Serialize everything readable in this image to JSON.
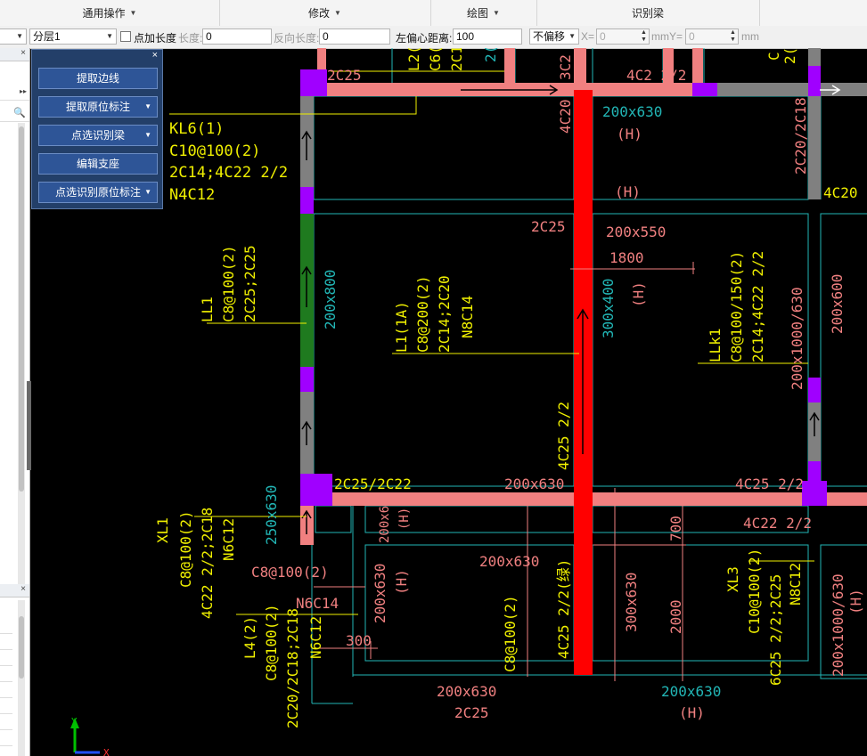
{
  "ribbon": {
    "groups": [
      {
        "label": "通用操作",
        "caret": "▼"
      },
      {
        "label": "修改",
        "caret": "▼"
      },
      {
        "label": "绘图",
        "caret": "▼"
      },
      {
        "label": "识别梁",
        "caret": ""
      }
    ]
  },
  "options": {
    "layer_value": "分层1",
    "add_length_label": "点加长度",
    "length_label": "长度:",
    "length_value": "0",
    "reverse_length_label": "反向长度:",
    "reverse_length_value": "0",
    "left_offset_label": "左偏心距离:",
    "left_offset_value": "100",
    "offset_mode_value": "不偏移",
    "x_label": "X=",
    "x_value": "0",
    "mm_y_label": "mmY=",
    "y_value": "0",
    "mm_label": "mm"
  },
  "left_pane": {
    "close": "×",
    "arrows": "▸▸",
    "close2": "×"
  },
  "tool_panel": {
    "close": "×",
    "buttons": [
      {
        "label": "提取边线",
        "caret": ""
      },
      {
        "label": "提取原位标注",
        "caret": "▼"
      },
      {
        "label": "点选识别梁",
        "caret": "▼"
      },
      {
        "label": "编辑支座",
        "caret": ""
      },
      {
        "label": "点选识别原位标注",
        "caret": "▼"
      }
    ]
  },
  "colors": {
    "pink": "#f08080",
    "red": "#ff0000",
    "cyan": "#22b6b6",
    "yellow": "#f0f000",
    "purple": "#a000ff",
    "gray": "#808080",
    "green": "#1f7a1f"
  },
  "drawing": {
    "kl6": [
      "KL6(1)",
      "C10@100(2)",
      "2C14;4C22 2/2",
      "N4C12"
    ],
    "ll1": [
      "LL1",
      "C8@100(2)",
      "2C25;2C25"
    ],
    "l1": [
      "L1(1A)",
      "C8@200(2)",
      "2C14;2C20",
      "N8C14"
    ],
    "llk1": [
      "LLk1",
      "C8@100/150(2)",
      "2C14;4C22 2/2"
    ],
    "xl1": [
      "XL1",
      "C8@100(2)",
      "4C22 2/2;2C18",
      "N6C12"
    ],
    "l4": [
      "L4(2)",
      "C8@100(2)",
      "2C20/2C18;2C18",
      "N6C12"
    ],
    "xl3": [
      "XL3",
      "C10@100(2)",
      "6C25 2/2;2C25",
      "N8C12"
    ],
    "top_fragments": [
      "2C25",
      "L2(",
      "C6(",
      "2C1",
      "2(",
      "3C2",
      "4C2 2/2",
      "C",
      "2("
    ],
    "pink_texts": [
      "4C20",
      "2C25",
      "200x550",
      "1800",
      "200x630",
      "2C25/2C22",
      "4C25 2/2",
      "4C22 2/2",
      "200x630",
      "C8@100(2)",
      "N6C14",
      "300",
      "200x63",
      "200x630",
      "200x630",
      "C8@100(2)",
      "300x630",
      "2000",
      "700",
      "200x630",
      "(H)",
      "(H)",
      "(H)",
      "(H)",
      "(H)",
      "(H)",
      "(H)",
      "2C25",
      "200x1000/630",
      "(H)"
    ],
    "cyan_texts": [
      "200x630",
      "(H)",
      "200x800",
      "300x400",
      "(H)",
      "200x600",
      "250x630",
      "200x630",
      "(H)",
      "2C20/2C18"
    ],
    "yellow_texts": [
      "4C25 2/2",
      "4C25 2/2(绿)",
      "4C20 2",
      "C8@100(2)"
    ]
  }
}
